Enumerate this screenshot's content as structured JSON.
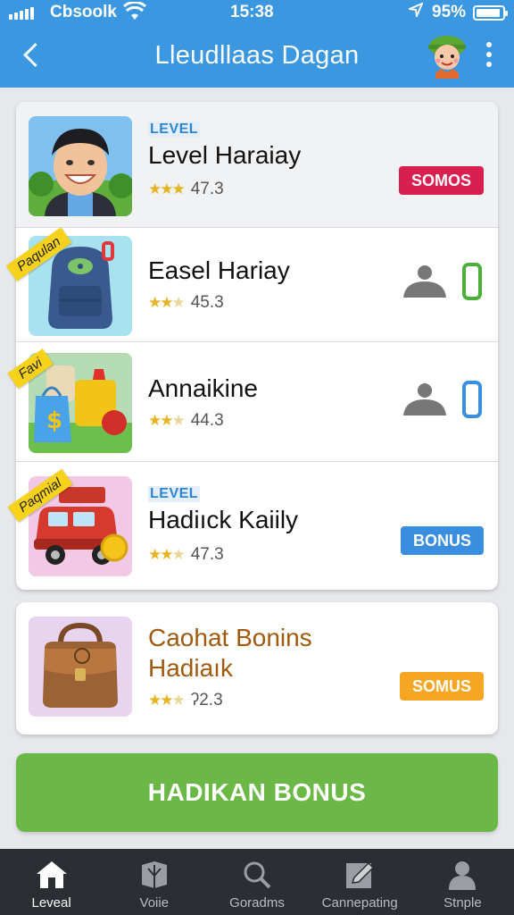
{
  "status_bar": {
    "carrier": "Cbsoolk",
    "time": "15:38",
    "battery": "95%"
  },
  "header": {
    "title": "Lleudllaas Dagan"
  },
  "items": [
    {
      "level_tag": "LEVEL",
      "name": "Level Haraiay",
      "rating": "47.3",
      "stars": 3,
      "badge": "SOMOS",
      "badge_color": "#d81f4f"
    },
    {
      "ribbon": "Paqulan",
      "name": "Easel Hariay",
      "rating": "45.3",
      "stars": 2.5,
      "toggle_color": "#4caf3a"
    },
    {
      "ribbon": "Favi",
      "name": "Annaikine",
      "rating": "44.3",
      "stars": 2.5,
      "toggle_color": "#3a8ee0"
    },
    {
      "ribbon": "Paqmial",
      "level_tag": "LEVEL",
      "name": "Hadiıck Kaiily",
      "rating": "47.3",
      "stars": 2.5,
      "badge": "BONUS",
      "badge_color": "#3a8ee0"
    }
  ],
  "featured": {
    "name_line1": "Caohat Bonins",
    "name_line2": "Hadiaık",
    "rating": "ʔ2.3",
    "stars": 2.5,
    "badge": "SOMUS",
    "badge_color": "#f5a623"
  },
  "cta": {
    "label": "HADIKAN BONUS",
    "color": "#6bb847"
  },
  "bottom_nav": [
    {
      "label": "Leveal",
      "icon": "home-icon",
      "active": true
    },
    {
      "label": "Voiie",
      "icon": "gift-box-icon",
      "active": false
    },
    {
      "label": "Goradms",
      "icon": "search-icon",
      "active": false
    },
    {
      "label": "Cannepating",
      "icon": "edit-icon",
      "active": false
    },
    {
      "label": "Stnple",
      "icon": "profile-icon",
      "active": false
    }
  ],
  "colors": {
    "header": "#3b97e0",
    "nav": "#2b2e33"
  }
}
